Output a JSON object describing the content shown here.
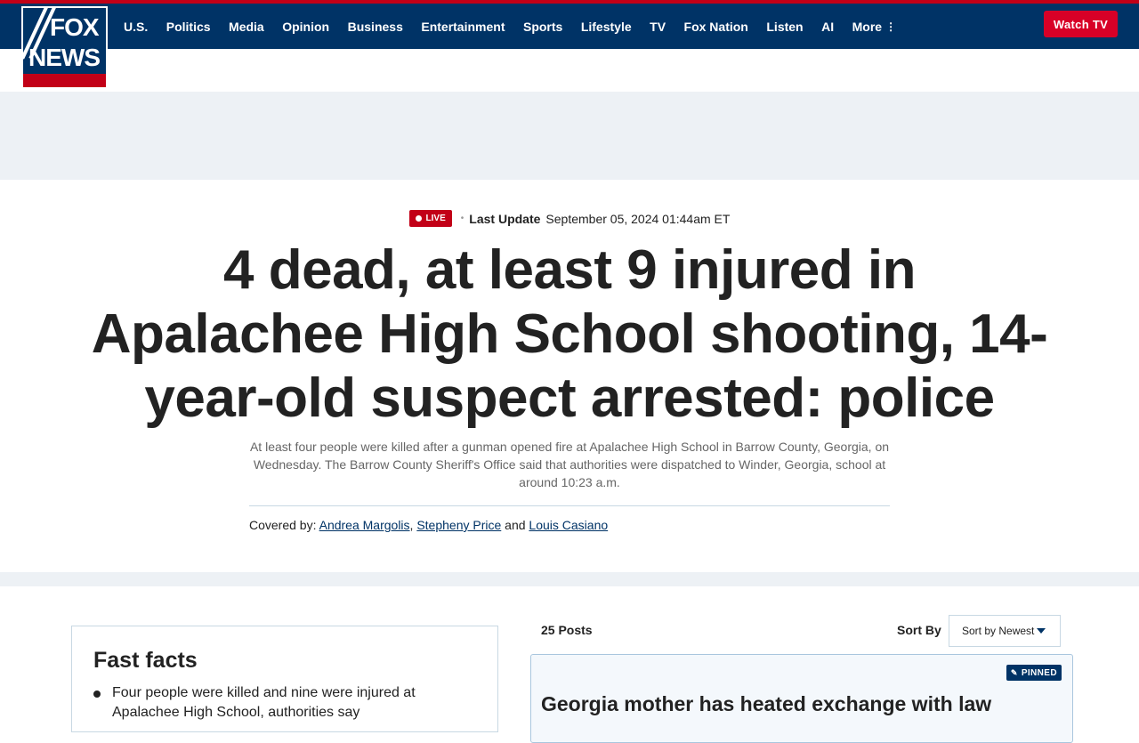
{
  "brand": {
    "logo_top": "FOX",
    "logo_bottom": "NEWS",
    "colors": {
      "navy": "#003366",
      "red": "#c20017",
      "watch_red": "#d80027"
    }
  },
  "nav": {
    "items": [
      "U.S.",
      "Politics",
      "Media",
      "Opinion",
      "Business",
      "Entertainment",
      "Sports",
      "Lifestyle",
      "TV",
      "Fox Nation",
      "Listen",
      "AI"
    ],
    "more_label": "More",
    "watch_label": "Watch TV"
  },
  "article": {
    "live_label": "LIVE",
    "last_update_label": "Last Update",
    "last_update_time": "September 05, 2024 01:44am ET",
    "headline": "4 dead, at least 9 injured in Apalachee High School shooting, 14-year-old suspect arrested: police",
    "dek": "At least four people were killed after a gunman opened fire at Apalachee High School in Barrow County, Georgia, on Wednesday. The Barrow County Sheriff's Office said that authorities were dispatched to Winder, Georgia, school at around 10:23 a.m.",
    "covered_by_label": "Covered by:",
    "authors": [
      "Andrea Margolis",
      "Stepheny Price",
      "Louis Casiano"
    ],
    "authors_sep1": ",",
    "authors_and": "and"
  },
  "fast_facts": {
    "title": "Fast facts",
    "items": [
      "Four people were killed and nine were injured at Apalachee High School, authorities say"
    ]
  },
  "live_feed": {
    "posts_count": "25 Posts",
    "sort_label": "Sort By",
    "sort_value": "Sort by Newest",
    "pinned_label": "PINNED",
    "first_post_title": "Georgia mother has heated exchange with law"
  }
}
